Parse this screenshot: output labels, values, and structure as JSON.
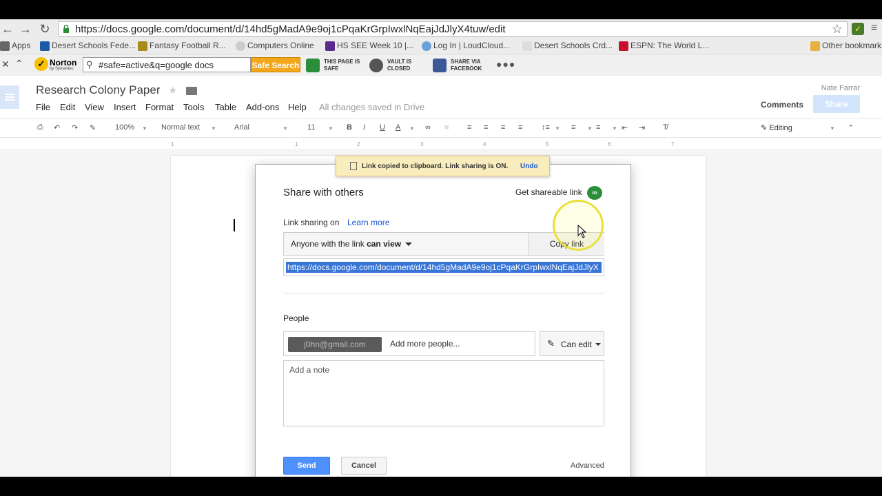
{
  "browser": {
    "url": "https://docs.google.com/document/d/14hd5gMadA9e9oj1cPqaKrGrpIwxlNqEajJdJlyX4tuw/edit",
    "bookmarks": [
      "Apps",
      "Desert Schools Fede...",
      "Fantasy Football R...",
      "Computers Online",
      "HS SEE Week 10 |...",
      "Log In | LoudCloud...",
      "Desert Schools Crd...",
      "ESPN: The World L...",
      "Other bookmarks"
    ]
  },
  "norton": {
    "brand": "Norton",
    "brand_sub": "by Symantec",
    "search_value": "#safe=active&q=google docs",
    "safe_search_label": "Safe Search",
    "page_safe_label": "THIS PAGE IS SAFE",
    "vault_label": "VAULT IS CLOSED",
    "share_fb_label": "SHARE VIA FACEBOOK",
    "more_dots": "●●●"
  },
  "docs": {
    "title": "Research Colony Paper",
    "user_name": "Nate Farrar",
    "comments_label": "Comments",
    "share_label": "Share",
    "menu": [
      "File",
      "Edit",
      "View",
      "Insert",
      "Format",
      "Tools",
      "Table",
      "Add-ons",
      "Help"
    ],
    "saved_status": "All changes saved in Drive",
    "toolbar": {
      "zoom": "100%",
      "style": "Normal text",
      "font": "Arial",
      "size": "11",
      "editing": "Editing"
    },
    "ruler_marks": [
      "1",
      "1",
      "2",
      "3",
      "4",
      "5",
      "6",
      "7"
    ]
  },
  "toast": {
    "message": "Link copied to clipboard. Link sharing is ON.",
    "undo": "Undo"
  },
  "share_dialog": {
    "title": "Share with others",
    "get_link_label": "Get shareable link",
    "link_sharing_label": "Link sharing on",
    "learn_more": "Learn more",
    "access_prefix": "Anyone with the link ",
    "access_bold": "can view",
    "copy_link": "Copy link",
    "share_url": "https://docs.google.com/document/d/14hd5gMadA9e9oj1cPqaKrGrpIwxlNqEajJdJlyX",
    "people_label": "People",
    "chip_text": "j0hn@gmail.com",
    "add_people_placeholder": "Add more people...",
    "permission": "Can edit",
    "note_placeholder": "Add a note",
    "send": "Send",
    "cancel": "Cancel",
    "advanced": "Advanced"
  }
}
